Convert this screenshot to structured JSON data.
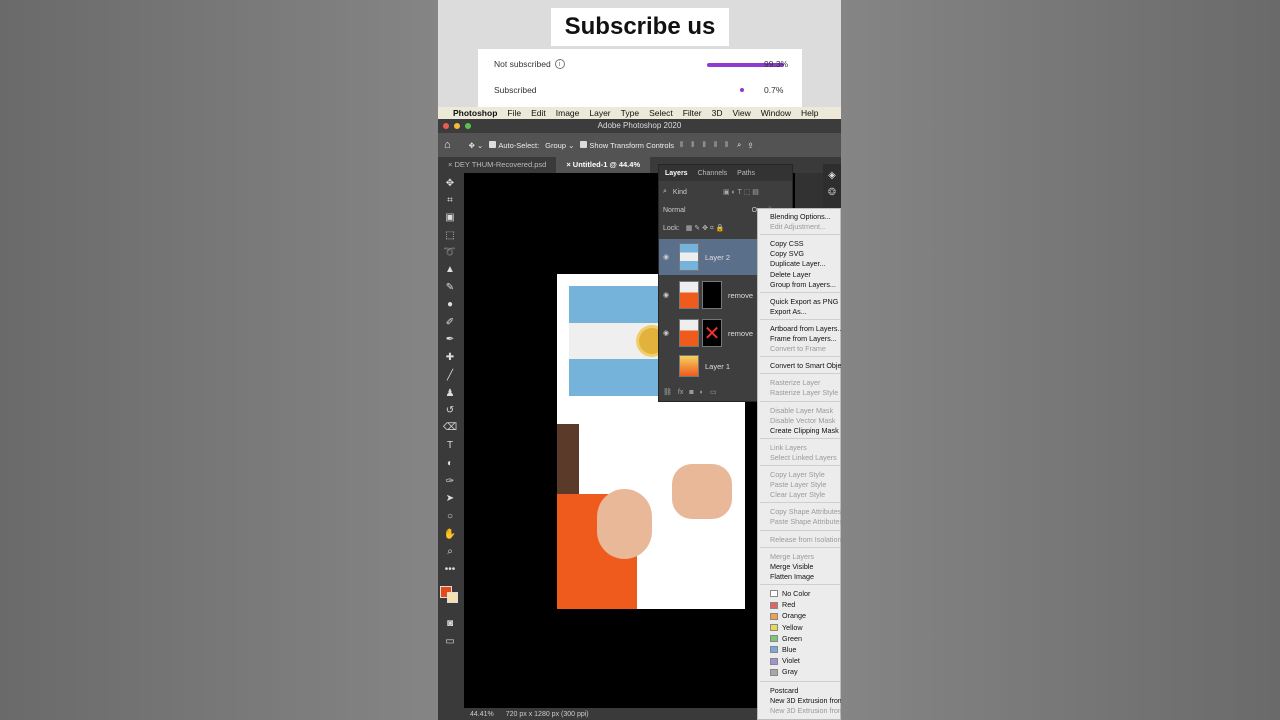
{
  "subscribe_title": "Subscribe us",
  "poll": {
    "rows": [
      {
        "label": "Not subscribed",
        "percent_text": "99.3%",
        "value": 0.993
      },
      {
        "label": "Subscribed",
        "percent_text": "0.7%",
        "value": 0.007
      }
    ],
    "accent": "#8e3bd0"
  },
  "mac_menu": [
    "Photoshop",
    "File",
    "Edit",
    "Image",
    "Layer",
    "Type",
    "Select",
    "Filter",
    "3D",
    "View",
    "Window",
    "Help"
  ],
  "window_title": "Adobe Photoshop 2020",
  "options_bar": {
    "auto_select": "Auto-Select:",
    "group": "Group",
    "show_transform": "Show Transform Controls"
  },
  "doc_tabs": [
    "DEY THUM-Recovered.psd",
    "Untitled-1 @ 44.4%"
  ],
  "status": {
    "zoom": "44.41%",
    "size": "720 px x 1280 px (300 ppi)"
  },
  "layers_panel": {
    "tabs": [
      "Layers",
      "Channels",
      "Paths"
    ],
    "kind": "Kind",
    "blend": "Normal",
    "opacity_label": "Opacity:",
    "lock_label": "Lock:",
    "layers": [
      "Layer 2",
      "remove",
      "remove",
      "Layer 1"
    ]
  },
  "context_menu": {
    "items": [
      {
        "label": "Blending Options...",
        "enabled": true
      },
      {
        "label": "Edit Adjustment...",
        "enabled": false
      },
      {
        "label": "Copy CSS",
        "enabled": true
      },
      {
        "label": "Copy SVG",
        "enabled": true
      },
      {
        "label": "Duplicate Layer...",
        "enabled": true
      },
      {
        "label": "Delete Layer",
        "enabled": true
      },
      {
        "label": "Group from Layers...",
        "enabled": true
      },
      {
        "label": "Quick Export as PNG",
        "enabled": true
      },
      {
        "label": "Export As...",
        "enabled": true
      },
      {
        "label": "Artboard from Layers...",
        "enabled": true
      },
      {
        "label": "Frame from Layers...",
        "enabled": true
      },
      {
        "label": "Convert to Frame",
        "enabled": false
      },
      {
        "label": "Convert to Smart Object",
        "enabled": true
      },
      {
        "label": "Rasterize Layer",
        "enabled": false
      },
      {
        "label": "Rasterize Layer Style",
        "enabled": false
      },
      {
        "label": "Disable Layer Mask",
        "enabled": false
      },
      {
        "label": "Disable Vector Mask",
        "enabled": false
      },
      {
        "label": "Create Clipping Mask",
        "enabled": true
      },
      {
        "label": "Link Layers",
        "enabled": false
      },
      {
        "label": "Select Linked Layers",
        "enabled": false
      },
      {
        "label": "Copy Layer Style",
        "enabled": false
      },
      {
        "label": "Paste Layer Style",
        "enabled": false
      },
      {
        "label": "Clear Layer Style",
        "enabled": false
      },
      {
        "label": "Copy Shape Attributes",
        "enabled": false
      },
      {
        "label": "Paste Shape Attributes",
        "enabled": false
      },
      {
        "label": "Release from Isolation",
        "enabled": false
      },
      {
        "label": "Merge Layers",
        "enabled": false
      },
      {
        "label": "Merge Visible",
        "enabled": true
      },
      {
        "label": "Flatten Image",
        "enabled": true
      }
    ],
    "colors": [
      {
        "label": "No Color",
        "color": "#ffffff"
      },
      {
        "label": "Red",
        "color": "#e06666"
      },
      {
        "label": "Orange",
        "color": "#f0a050"
      },
      {
        "label": "Yellow",
        "color": "#e8d85a"
      },
      {
        "label": "Green",
        "color": "#78c878"
      },
      {
        "label": "Blue",
        "color": "#78a8e0"
      },
      {
        "label": "Violet",
        "color": "#a890d8"
      },
      {
        "label": "Gray",
        "color": "#a8a8a8"
      }
    ],
    "footer": [
      {
        "label": "Postcard",
        "enabled": true
      },
      {
        "label": "New 3D Extrusion from",
        "enabled": true
      },
      {
        "label": "New 3D Extrusion from",
        "enabled": false
      }
    ]
  }
}
